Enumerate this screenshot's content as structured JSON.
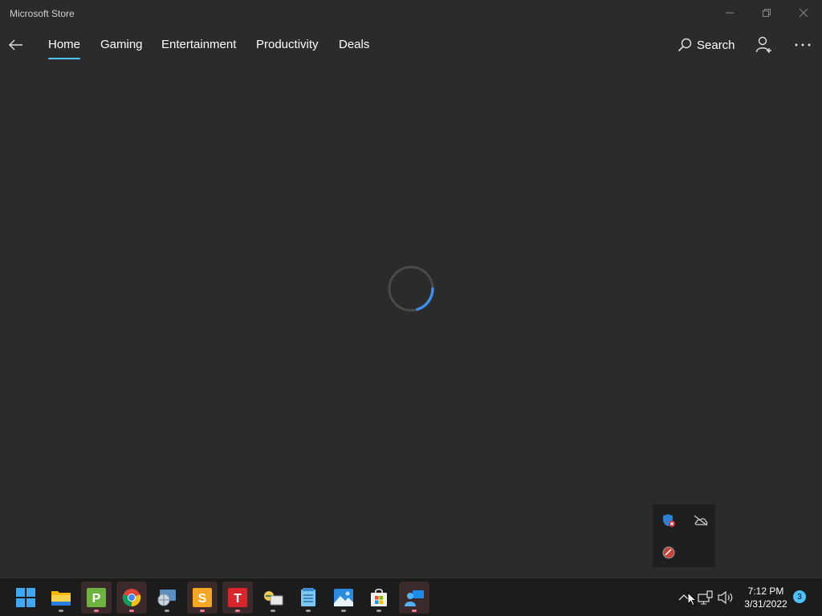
{
  "window": {
    "title": "Microsoft Store",
    "controls": [
      "minimize",
      "restore",
      "close"
    ]
  },
  "nav": {
    "tabs": [
      {
        "label": "Home",
        "active": true
      },
      {
        "label": "Gaming",
        "active": false
      },
      {
        "label": "Entertainment",
        "active": false
      },
      {
        "label": "Productivity",
        "active": false
      },
      {
        "label": "Deals",
        "active": false
      }
    ],
    "search_label": "Search",
    "icons": {
      "back": "back-arrow-icon",
      "search": "search-icon",
      "account": "add-account-icon",
      "more": "more-ellipsis-icon"
    }
  },
  "main": {
    "state": "loading",
    "spinner_icon": "loading-spinner-icon"
  },
  "tray_flyout": {
    "icons": [
      "defender-warning-icon",
      "onedrive-offline-icon",
      "app-red-circle-icon"
    ]
  },
  "taskbar": {
    "apps": [
      {
        "name": "start",
        "icon": "windows-start-icon",
        "running": false
      },
      {
        "name": "file-explorer",
        "icon": "folder-icon",
        "running": true
      },
      {
        "name": "p-app",
        "icon": "p-app-icon",
        "letter": "P",
        "running": true
      },
      {
        "name": "chrome",
        "icon": "chrome-icon",
        "running": true
      },
      {
        "name": "network-app",
        "icon": "globe-monitor-icon",
        "running": true
      },
      {
        "name": "s-app",
        "icon": "s-app-icon",
        "letter": "S",
        "running": true
      },
      {
        "name": "t-app",
        "icon": "t-app-icon",
        "letter": "T",
        "running": true
      },
      {
        "name": "photo-viewer",
        "icon": "photo-folder-icon",
        "running": true
      },
      {
        "name": "notepad",
        "icon": "notepad-icon",
        "running": true
      },
      {
        "name": "photos",
        "icon": "photos-icon",
        "running": true
      },
      {
        "name": "microsoft-store",
        "icon": "store-bag-icon",
        "running": true
      },
      {
        "name": "remote-app",
        "icon": "remote-support-icon",
        "running": true
      }
    ],
    "system_tray": {
      "icons": [
        "chevron-up-icon",
        "network-icon",
        "volume-icon"
      ]
    },
    "clock": {
      "time": "7:12 PM",
      "date": "3/31/2022"
    },
    "notifications": "3"
  },
  "colors": {
    "accent": "#4cc2ff",
    "background": "#2b2b2b",
    "taskbar": "#1c1c1c"
  }
}
